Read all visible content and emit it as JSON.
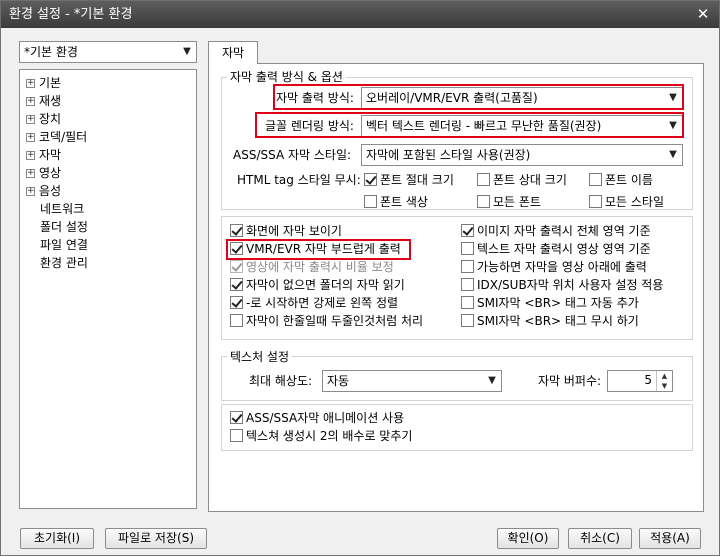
{
  "window": {
    "title": "환경 설정 - *기본 환경",
    "close_glyph": "✕"
  },
  "preset": {
    "value": "*기본 환경"
  },
  "tree": {
    "items": [
      {
        "label": "기본",
        "expandable": true
      },
      {
        "label": "재생",
        "expandable": true
      },
      {
        "label": "장치",
        "expandable": true
      },
      {
        "label": "코덱/필터",
        "expandable": true
      },
      {
        "label": "자막",
        "expandable": true
      },
      {
        "label": "영상",
        "expandable": true
      },
      {
        "label": "음성",
        "expandable": true
      },
      {
        "label": "네트워크",
        "expandable": false
      },
      {
        "label": "폴더 설정",
        "expandable": false
      },
      {
        "label": "파일 연결",
        "expandable": false
      },
      {
        "label": "환경 관리",
        "expandable": false
      }
    ]
  },
  "tab": {
    "label": "자막"
  },
  "output_group": {
    "title": "자막 출력 방식 & 옵션",
    "output_method_label": "자막 출력 방식:",
    "output_method_value": "오버레이/VMR/EVR 출력(고품질)",
    "font_render_label": "글꼴 렌더링 방식:",
    "font_render_value": "벡터 텍스트 렌더링 - 빠르고 무난한 품질(권장)",
    "ass_style_label": "ASS/SSA 자막 스타일:",
    "ass_style_value": "자막에 포함된 스타일 사용(권장)",
    "html_ignore_label": "HTML tag 스타일 무시:",
    "html_options": [
      {
        "label": "폰트 절대 크기",
        "checked": true
      },
      {
        "label": "폰트 상대 크기",
        "checked": false
      },
      {
        "label": "폰트 이름",
        "checked": false
      },
      {
        "label": "폰트 색상",
        "checked": false
      },
      {
        "label": "모든 폰트",
        "checked": false
      },
      {
        "label": "모든 스타일",
        "checked": false
      }
    ]
  },
  "options_left": [
    {
      "label": "화면에 자막 보이기",
      "checked": true,
      "disabled": false
    },
    {
      "label": "VMR/EVR 자막 부드럽게 출력",
      "checked": true,
      "disabled": false
    },
    {
      "label": "영상에 자막 출력시 비율 보정",
      "checked": true,
      "disabled": true
    },
    {
      "label": "자막이 없으면 폴더의 자막 읽기",
      "checked": true,
      "disabled": false
    },
    {
      "label": "-로 시작하면 강제로 왼쪽 정렬",
      "checked": true,
      "disabled": false
    },
    {
      "label": "자막이 한줄일때 두줄인것처럼 처리",
      "checked": false,
      "disabled": false
    }
  ],
  "options_right": [
    {
      "label": "이미지 자막 출력시 전체 영역 기준",
      "checked": true
    },
    {
      "label": "텍스트 자막 출력시 영상 영역 기준",
      "checked": false
    },
    {
      "label": "가능하면 자막을 영상 아래에 출력",
      "checked": false
    },
    {
      "label": "IDX/SUB자막 위치 사용자 설정 적용",
      "checked": false
    },
    {
      "label": "SMI자막 <BR> 태그 자동 추가",
      "checked": false
    },
    {
      "label": "SMI자막 <BR> 태그 무시 하기",
      "checked": false
    }
  ],
  "texture_group": {
    "title": "텍스처 설정",
    "max_res_label": "최대 해상도:",
    "max_res_value": "자동",
    "buffer_label": "자막 버퍼수:",
    "buffer_value": "5"
  },
  "bottom_options": [
    {
      "label": "ASS/SSA자막 애니메이션 사용",
      "checked": true
    },
    {
      "label": "텍스쳐 생성시 2의 배수로 맞추기",
      "checked": false
    }
  ],
  "buttons": {
    "reset": "초기화(I)",
    "save_file": "파일로 저장(S)",
    "ok": "확인(O)",
    "cancel": "취소(C)",
    "apply": "적용(A)"
  },
  "colors": {
    "highlight": "#e0001a",
    "titlebar": "#4a4a4a"
  }
}
